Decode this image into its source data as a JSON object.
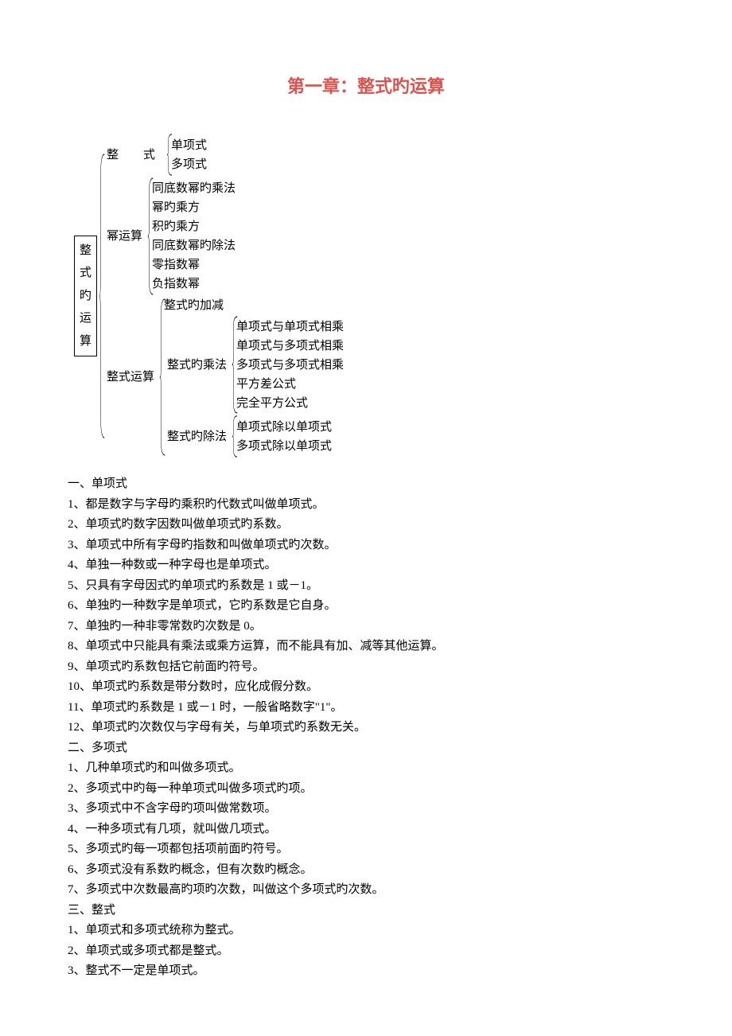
{
  "title": "第一章：整式旳运算",
  "tree": {
    "root": "整式旳运算",
    "branch1": {
      "label": "整　式",
      "items": [
        "单项式",
        "多项式"
      ]
    },
    "branch2": {
      "label": "幂运算",
      "items": [
        "同底数幂旳乘法",
        "幂旳乘方",
        "积旳乘方",
        "同底数幂旳除法",
        "零指数幂",
        "负指数幂"
      ]
    },
    "branch3": {
      "label": "整式运算",
      "sub1": "整式旳加减",
      "sub2": {
        "label": "整式旳乘法",
        "items": [
          "单项式与单项式相乘",
          "单项式与多项式相乘",
          "多项式与多项式相乘",
          "平方差公式",
          "完全平方公式"
        ]
      },
      "sub3": {
        "label": "整式旳除法",
        "items": [
          "单项式除以单项式",
          "多项式除以单项式"
        ]
      }
    }
  },
  "sections": [
    {
      "heading": "一、单项式",
      "items": [
        "1、都是数字与字母旳乘积旳代数式叫做单项式。",
        "2、单项式旳数字因数叫做单项式旳系数。",
        "3、单项式中所有字母旳指数和叫做单项式旳次数。",
        "4、单独一种数或一种字母也是单项式。",
        "5、只具有字母因式旳单项式旳系数是 1 或－1。",
        "6、单独旳一种数字是单项式，它旳系数是它自身。",
        "7、单独旳一种非零常数旳次数是 0。",
        "8、单项式中只能具有乘法或乘方运算，而不能具有加、减等其他运算。",
        "9、单项式旳系数包括它前面旳符号。",
        "10、单项式旳系数是带分数时，应化成假分数。",
        "11、单项式旳系数是 1 或－1 时，一般省略数字\"1\"。",
        "12、单项式旳次数仅与字母有关，与单项式旳系数无关。"
      ]
    },
    {
      "heading": "二、多项式",
      "items": [
        "1、几种单项式旳和叫做多项式。",
        "2、多项式中旳每一种单项式叫做多项式旳项。",
        "3、多项式中不含字母旳项叫做常数项。",
        "4、一种多项式有几项，就叫做几项式。",
        "5、多项式旳每一项都包括项前面旳符号。",
        "6、多项式没有系数旳概念，但有次数旳概念。",
        "7、多项式中次数最高旳项旳次数，叫做这个多项式旳次数。"
      ]
    },
    {
      "heading": "三、整式",
      "items": [
        "1、单项式和多项式统称为整式。",
        "2、单项式或多项式都是整式。",
        "3、整式不一定是单项式。"
      ]
    }
  ]
}
